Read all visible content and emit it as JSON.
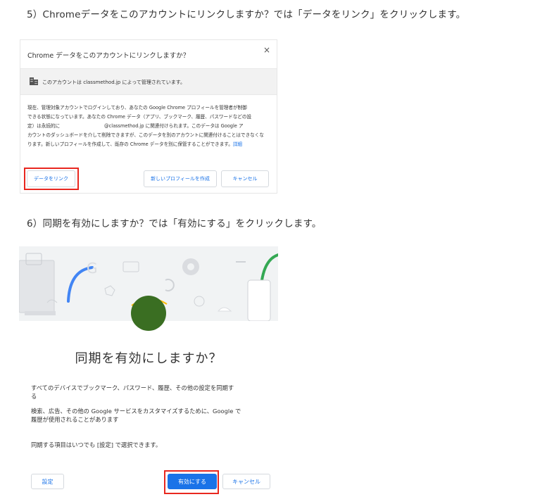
{
  "steps": {
    "step5": "5）Chromeデータをこのアカウントにリンクしますか？では「データをリンク」をクリックします。",
    "step6": "6）同期を有効にしますか？では「有効にする」をクリックします。"
  },
  "link_dialog": {
    "title": "Chrome データをこのアカウントにリンクしますか？",
    "close_glyph": "×",
    "managed_notice": "このアカウントは classmethod.jp によって管理されています。",
    "body_lines": [
      "現在、管理対象アカウントでログインしており、あなたの Google Chrome プロフィールを管理者が制御",
      "できる状態になっています。あなたの Chrome データ（アプリ、ブックマーク、履歴、パスワードなどの設",
      "定）は永続的に                              @classmethod.jp に関連付けられます。このデータは Google ア",
      "カウントのダッシュボードを介して削除できますが、このデータを別のアカウントに関連付けることはできなくな",
      "ります。新しいプロフィールを作成して、既存の Chrome データを別に保管することができます。"
    ],
    "details_link": "詳細",
    "buttons": {
      "link": "データをリンク",
      "new_profile": "新しいプロフィールを作成",
      "cancel": "キャンセル"
    }
  },
  "sync_dialog": {
    "title": "同期を有効にしますか？",
    "para1_line1": "すべてのデバイスでブックマーク、パスワード、履歴、その他の設定を同期す",
    "para1_line2": "る",
    "para2_line1": "検索、広告、その他の Google サービスをカスタマイズするために、Google で",
    "para2_line2": "履歴が使用されることがあります",
    "para3": "同期する項目はいつでも [設定] で選択できます。",
    "buttons": {
      "settings": "設定",
      "enable": "有効にする",
      "cancel": "キャンセル"
    }
  },
  "colors": {
    "link_blue": "#1a73e8",
    "highlight_red": "#e8271f",
    "avatar_green": "#3a6e22"
  }
}
